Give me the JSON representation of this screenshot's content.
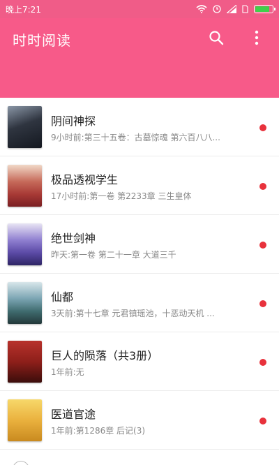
{
  "status_bar": {
    "time": "晚上7:21",
    "icons": [
      "wifi-icon",
      "alarm-icon",
      "signal-icon",
      "sim-icon",
      "battery-icon"
    ],
    "battery_level": 0.85,
    "battery_color": "#3fd04b"
  },
  "app_bar": {
    "title": "时时阅读",
    "color": "#f75a89",
    "actions": [
      "search-icon",
      "more-vert-icon"
    ]
  },
  "books": [
    {
      "title": "阴间神探",
      "subtitle": "9小时前:第三十五卷：古墓惊魂 第六百八八...",
      "unread": true,
      "cover": "cover-image"
    },
    {
      "title": "极品透视学生",
      "subtitle": "17小时前:第一卷 第2233章 三生皇体",
      "unread": true,
      "cover": "cover-image"
    },
    {
      "title": "绝世剑神",
      "subtitle": "昨天:第一卷 第二十一章 大道三千",
      "unread": true,
      "cover": "cover-image"
    },
    {
      "title": "仙都",
      "subtitle": "3天前:第十七章 元君镇瑶池，十恶动天机 ...",
      "unread": true,
      "cover": "cover-image"
    },
    {
      "title": "巨人的陨落（共3册）",
      "subtitle": "1年前:无",
      "unread": true,
      "cover": "cover-image"
    },
    {
      "title": "医道官途",
      "subtitle": "1年前:第1286章 后记(3)",
      "unread": true,
      "cover": "cover-image"
    }
  ],
  "colors": {
    "accent": "#f75a89",
    "unread_dot": "#e8323c"
  }
}
